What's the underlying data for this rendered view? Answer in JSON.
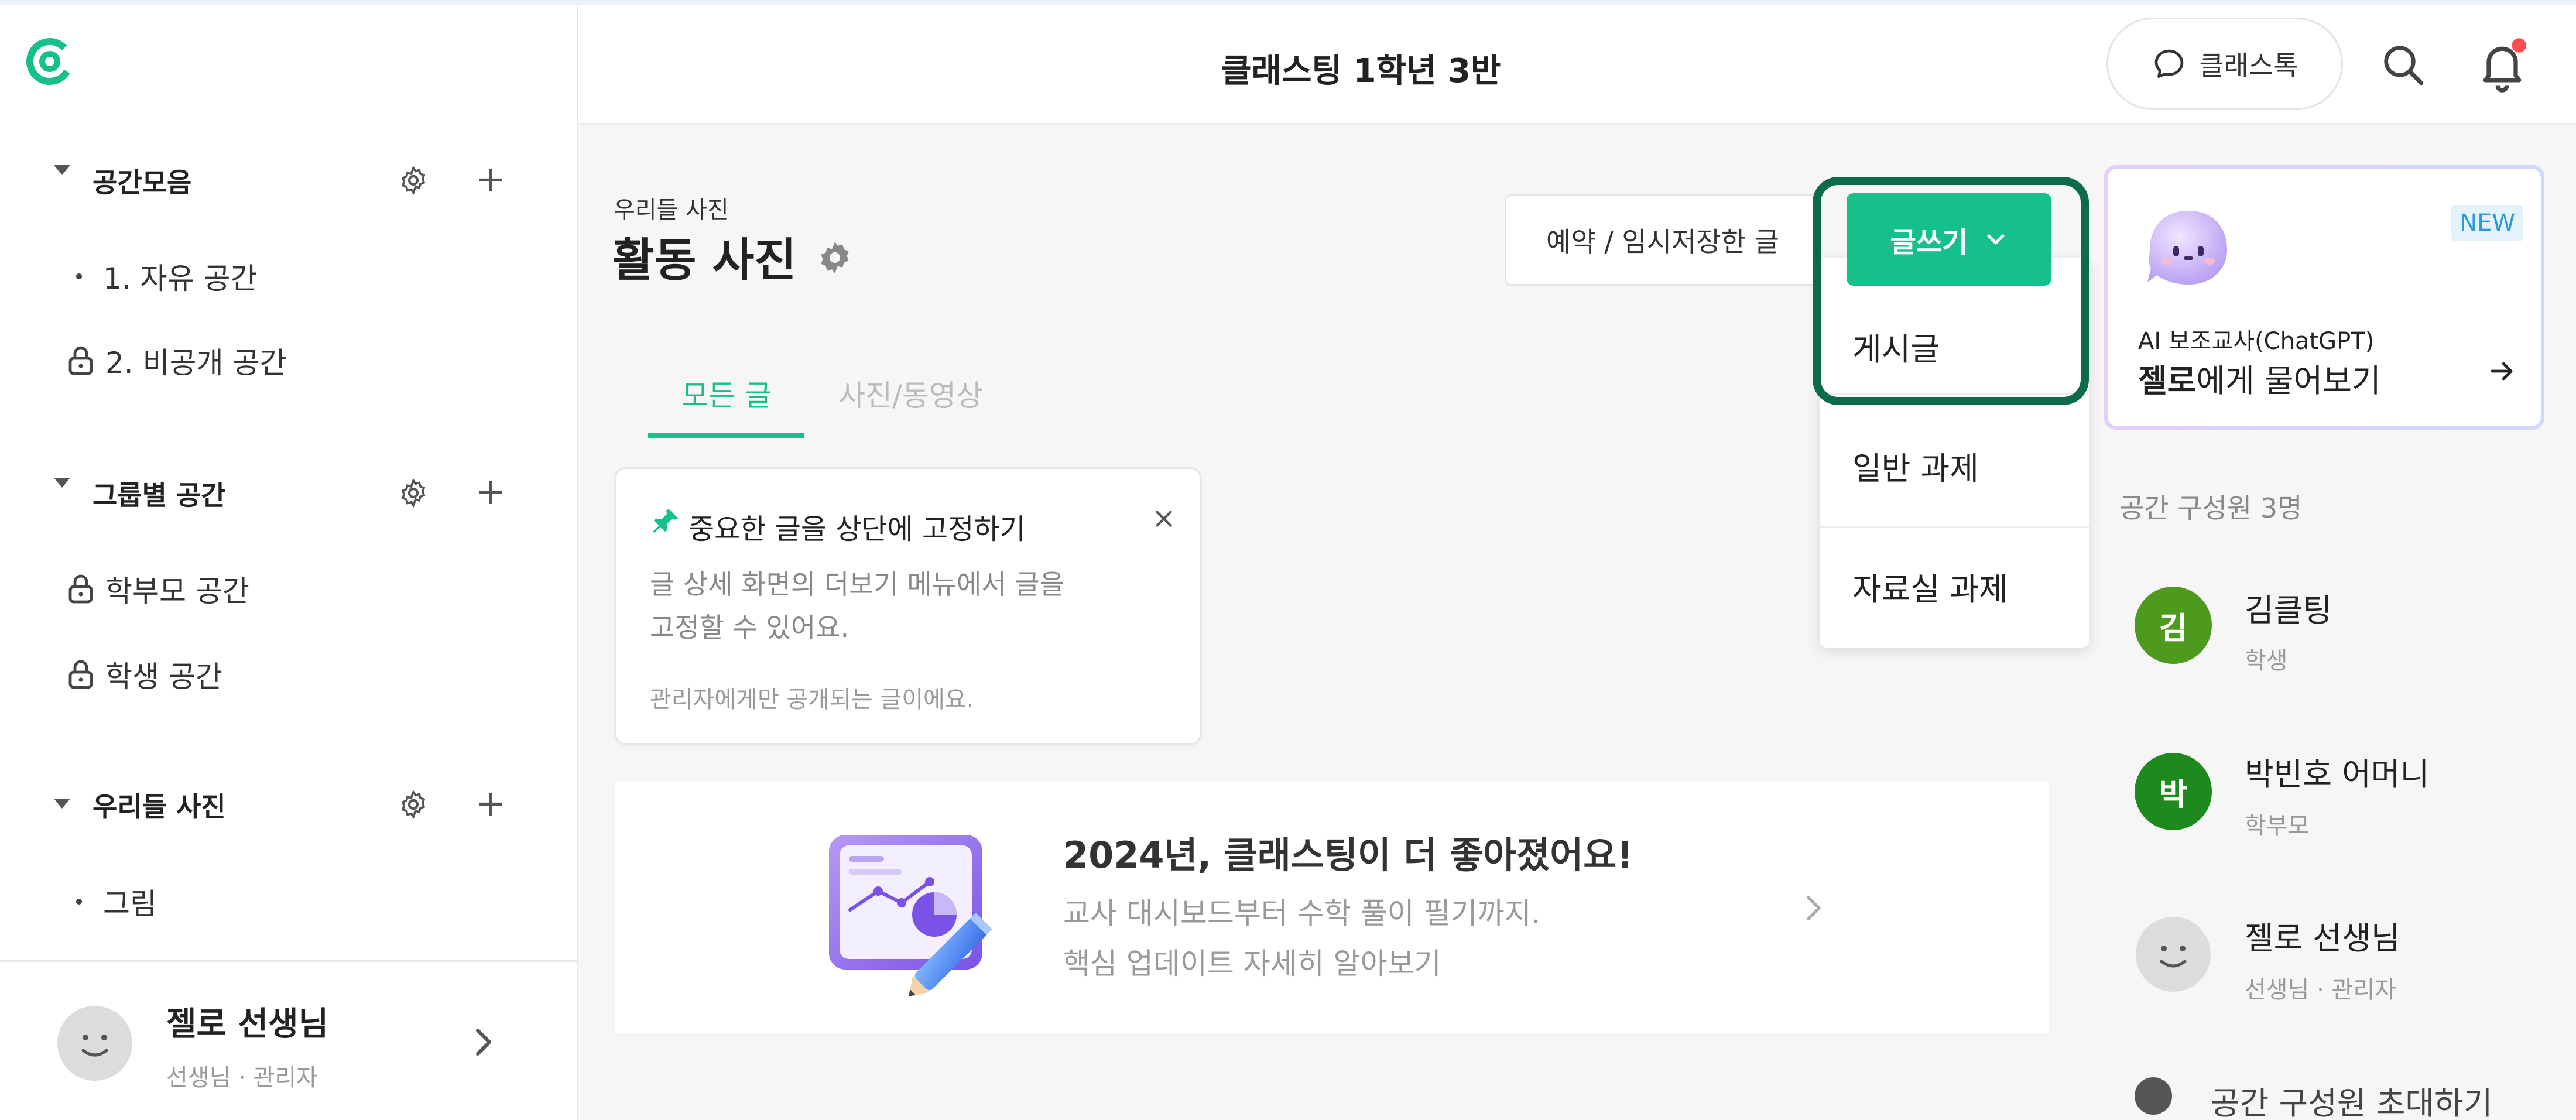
{
  "sidebar": {
    "sections": [
      {
        "title": "공간모음",
        "items": [
          {
            "label": "1. 자유 공간",
            "type": "bullet"
          },
          {
            "label": "2. 비공개 공간",
            "type": "lock"
          }
        ]
      },
      {
        "title": "그룹별 공간",
        "items": [
          {
            "label": "학부모 공간",
            "type": "lock"
          },
          {
            "label": "학생 공간",
            "type": "lock"
          }
        ]
      },
      {
        "title": "우리들 사진",
        "items": [
          {
            "label": "그림",
            "type": "bullet"
          }
        ]
      }
    ],
    "profile": {
      "name": "젤로 선생님",
      "role": "선생님 · 관리자"
    }
  },
  "header": {
    "title": "클래스팅 1학년 3반",
    "talk_label": "클래스톡"
  },
  "board": {
    "breadcrumb": "우리들 사진",
    "title": "활동 사진",
    "tabs": [
      {
        "label": "모든 글",
        "active": true
      },
      {
        "label": "사진/동영상",
        "active": false
      }
    ],
    "draft_label": "예약 / 임시저장한 글",
    "write_label": "글쓰기"
  },
  "dropdown": {
    "items": [
      "게시글",
      "일반 과제",
      "자료실 과제"
    ]
  },
  "pin_card": {
    "title": "중요한 글을 상단에 고정하기",
    "desc_line1": "글 상세 화면의 더보기 메뉴에서 글을",
    "desc_line2": "고정할 수 있어요.",
    "note": "관리자에게만 공개되는 글이에요."
  },
  "banner": {
    "title": "2024년, 클래스팅이 더 좋아졌어요!",
    "line1": "교사 대시보드부터 수학 풀이 필기까지.",
    "line2": "핵심 업데이트 자세히 알아보기"
  },
  "ai_card": {
    "badge": "NEW",
    "subtitle": "AI 보조교사(ChatGPT)",
    "title_bold": "젤로",
    "title_rest": "에게 물어보기"
  },
  "members": {
    "heading": "공간 구성원 3명",
    "list": [
      {
        "initial": "김",
        "name": "김클팅",
        "role": "학생",
        "color": "#4e9a1f"
      },
      {
        "initial": "박",
        "name": "박빈호 어머니",
        "role": "학부모",
        "color": "#1e8a1e"
      },
      {
        "initial": "",
        "name": "젤로 선생님",
        "role": "선생님 · 관리자",
        "color": "#d8d8d8"
      }
    ],
    "cut_label": "공간 구성원 초대하기"
  },
  "colors": {
    "accent": "#15c08b",
    "highlight": "#0c6b4b",
    "notification": "#ff4d4f"
  }
}
